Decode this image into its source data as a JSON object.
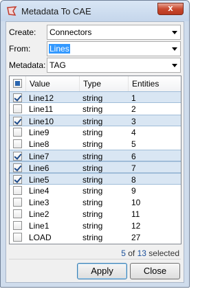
{
  "window": {
    "title": "Metadata To CAE",
    "close_label": "x"
  },
  "form": {
    "create_label": "Create:",
    "create_value": "Connectors",
    "from_label": "From:",
    "from_value": "Lines",
    "metadata_label": "Metadata:",
    "metadata_value": "TAG"
  },
  "table": {
    "columns": [
      "Value",
      "Type",
      "Entities"
    ],
    "rows": [
      {
        "value": "Line12",
        "type": "string",
        "entities": "1",
        "checked": true
      },
      {
        "value": "Line11",
        "type": "string",
        "entities": "2",
        "checked": false
      },
      {
        "value": "Line10",
        "type": "string",
        "entities": "3",
        "checked": true
      },
      {
        "value": "Line9",
        "type": "string",
        "entities": "4",
        "checked": false
      },
      {
        "value": "Line8",
        "type": "string",
        "entities": "5",
        "checked": false
      },
      {
        "value": "Line7",
        "type": "string",
        "entities": "6",
        "checked": true
      },
      {
        "value": "Line6",
        "type": "string",
        "entities": "7",
        "checked": true
      },
      {
        "value": "Line5",
        "type": "string",
        "entities": "8",
        "checked": true
      },
      {
        "value": "Line4",
        "type": "string",
        "entities": "9",
        "checked": false
      },
      {
        "value": "Line3",
        "type": "string",
        "entities": "10",
        "checked": false
      },
      {
        "value": "Line2",
        "type": "string",
        "entities": "11",
        "checked": false
      },
      {
        "value": "Line1",
        "type": "string",
        "entities": "12",
        "checked": false
      },
      {
        "value": "LOAD",
        "type": "string",
        "entities": "27",
        "checked": false
      }
    ]
  },
  "status": {
    "selected": "5",
    "of": "of",
    "total": "13",
    "suffix": "selected"
  },
  "buttons": {
    "apply": "Apply",
    "close": "Close"
  },
  "colors": {
    "accent": "#3399ff",
    "selected_row": "#d9e6f3",
    "close_button": "#c94a2f"
  }
}
